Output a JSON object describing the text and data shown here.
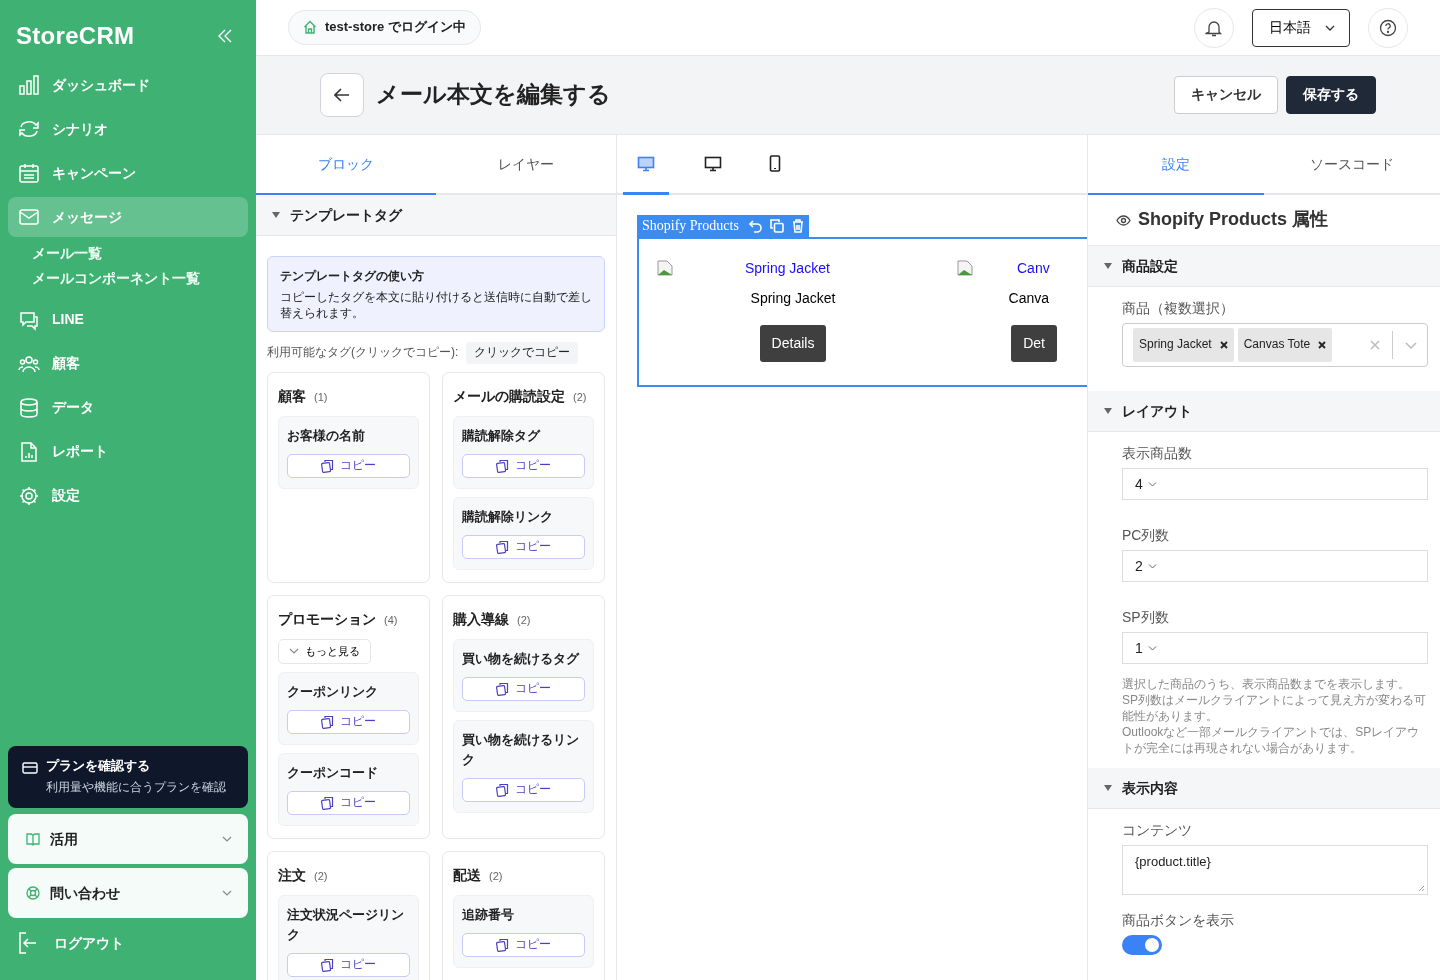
{
  "sidebar": {
    "logo": "StoreCRM",
    "nav": [
      {
        "label": "ダッシュボード",
        "selected": false
      },
      {
        "label": "シナリオ",
        "selected": false
      },
      {
        "label": "キャンペーン",
        "selected": false
      },
      {
        "label": "メッセージ",
        "selected": true,
        "children": [
          {
            "label": "メール一覧"
          },
          {
            "label": "メールコンポーネント一覧"
          }
        ]
      },
      {
        "label": "LINE",
        "selected": false
      },
      {
        "label": "顧客",
        "selected": false
      },
      {
        "label": "データ",
        "selected": false
      },
      {
        "label": "レポート",
        "selected": false
      },
      {
        "label": "設定",
        "selected": false
      }
    ],
    "plan": {
      "title": "プランを確認する",
      "subtitle": "利用量や機能に合うプランを確認"
    },
    "accordions": [
      {
        "label": "活用",
        "expanded": false
      },
      {
        "label": "問い合わせ",
        "expanded": false
      }
    ],
    "logout": "ログアウト"
  },
  "topbar": {
    "store": "test-store でログイン中",
    "language": "日本語"
  },
  "header": {
    "title": "メール本文を編集する",
    "buttons": [
      {
        "label": "キャンセル",
        "kind": "secondary"
      },
      {
        "label": "保存する",
        "kind": "primary"
      }
    ]
  },
  "left": {
    "tabs": [
      {
        "label": "ブロック",
        "selected": true
      },
      {
        "label": "レイヤー",
        "selected": false
      }
    ],
    "section": {
      "title": "テンプレートタグ",
      "expanded": true
    },
    "info": {
      "title": "テンプレートタグの使い方",
      "text": "コピーしたタグを本文に貼り付けると送信時に自動で差し替えられます。"
    },
    "tags_label": "利用可能なタグ(クリックでコピー):",
    "tags_chip": "クリックでコピー",
    "groups": [
      {
        "title": "顧客",
        "count": "(1)",
        "items": [
          {
            "name": "お客様の名前",
            "button": "コピー"
          }
        ]
      },
      {
        "title": "メールの購読設定",
        "count": "(2)",
        "items": [
          {
            "name": "購読解除タグ",
            "button": "コピー"
          },
          {
            "name": "購読解除リンク",
            "button": "コピー"
          }
        ]
      },
      {
        "title": "プロモーション",
        "count": "(4)",
        "more": "もっと見る",
        "items": [
          {
            "name": "クーポンリンク",
            "button": "コピー"
          },
          {
            "name": "クーポンコード",
            "button": "コピー"
          }
        ]
      },
      {
        "title": "購入導線",
        "count": "(2)",
        "items": [
          {
            "name": "買い物を続けるタグ",
            "button": "コピー"
          },
          {
            "name": "買い物を続けるリンク",
            "button": "コピー"
          }
        ]
      },
      {
        "title": "注文",
        "count": "(2)",
        "items": [
          {
            "name": "注文状況ページリンク",
            "button": "コピー"
          }
        ]
      },
      {
        "title": "配送",
        "count": "(2)",
        "items": [
          {
            "name": "追跡番号",
            "button": "コピー"
          }
        ]
      }
    ]
  },
  "canvas": {
    "device_tabs": [
      {
        "selected": true
      },
      {
        "selected": false
      },
      {
        "selected": false
      }
    ],
    "block": {
      "label": "Shopify Products",
      "products": [
        {
          "link": "Spring Jacket",
          "name": "Spring Jacket",
          "button": "Details"
        },
        {
          "link": "Canv",
          "name": "Canva",
          "button": "Det"
        }
      ]
    }
  },
  "right": {
    "tabs": [
      {
        "label": "設定",
        "selected": true
      },
      {
        "label": "ソースコード",
        "selected": false
      }
    ],
    "heading": "Shopify Products 属性",
    "sections": [
      {
        "title": "商品設定",
        "expanded": true,
        "fields": [
          {
            "kind": "multiselect",
            "label": "商品（複数選択）",
            "chips": [
              "Spring Jacket",
              "Canvas Tote"
            ]
          }
        ]
      },
      {
        "title": "レイアウト",
        "expanded": true,
        "fields": [
          {
            "kind": "select",
            "label": "表示商品数",
            "value": "4"
          },
          {
            "kind": "select",
            "label": "PC列数",
            "value": "2"
          },
          {
            "kind": "select",
            "label": "SP列数",
            "value": "1"
          },
          {
            "kind": "note",
            "lines": [
              "選択した商品のうち、表示商品数までを表示します。",
              "SP列数はメールクライアントによって見え方が変わる可能性があります。",
              "Outlookなど一部メールクライアントでは、SPレイアウトが完全には再現されない場合があります。"
            ]
          }
        ]
      },
      {
        "title": "表示内容",
        "expanded": true,
        "fields": [
          {
            "kind": "textarea",
            "label": "コンテンツ",
            "value": "{product.title}"
          },
          {
            "kind": "toggle",
            "label": "商品ボタンを表示",
            "on": true
          }
        ]
      }
    ]
  }
}
